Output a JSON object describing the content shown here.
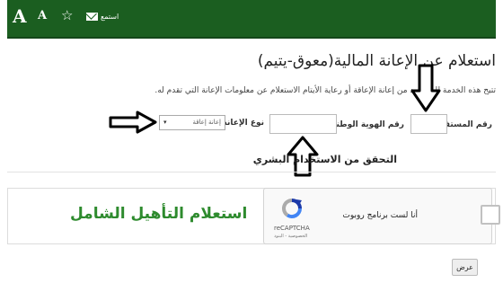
{
  "toolbar": {
    "font_large": "A",
    "font_small": "A",
    "star_icon": "☆",
    "listen": "استمع"
  },
  "page": {
    "title": "استعلام عن الإعانة المالية(معوق-يتيم)",
    "description": "تتيح هذه الخدمة للمستفيد من إعانة الإعاقة أو رعاية الأيتام الاستعلام عن معلومات الإعانة التي تقدم له."
  },
  "form": {
    "beneficiary_no_label": "رقم المستفيد",
    "national_id_label": "رقم الهوية الوطنية",
    "required_mark": "*",
    "aid_type_label": "نوع الإعانة",
    "aid_type_selected": "إعانة إعاقة",
    "select_arrow": "▾"
  },
  "verification": {
    "section_title": "التحقق من الاستخدام البشري",
    "checkbox_label": "أنا لست برنامج روبوت",
    "recaptcha_name": "reCAPTCHA",
    "recaptcha_links": "الخصوصية - البنود"
  },
  "banner": {
    "text": "استعلام التأهيل الشامل"
  },
  "submit_label": "عرض",
  "colors": {
    "header": "#1b5e20",
    "banner_text": "#2e8b2e",
    "required": "#cc0000"
  }
}
